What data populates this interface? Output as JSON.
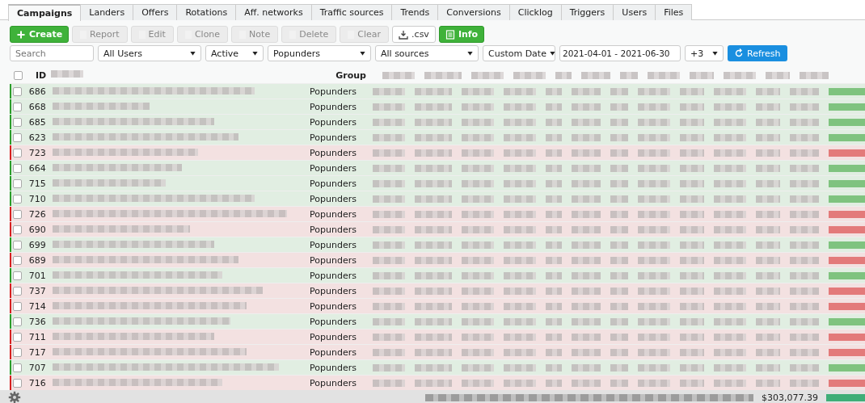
{
  "tabs": [
    {
      "label": "Campaigns",
      "selected": true
    },
    {
      "label": "Landers",
      "selected": false
    },
    {
      "label": "Offers",
      "selected": false
    },
    {
      "label": "Rotations",
      "selected": false
    },
    {
      "label": "Aff. networks",
      "selected": false
    },
    {
      "label": "Traffic sources",
      "selected": false
    },
    {
      "label": "Trends",
      "selected": false
    },
    {
      "label": "Conversions",
      "selected": false
    },
    {
      "label": "Clicklog",
      "selected": false
    },
    {
      "label": "Triggers",
      "selected": false
    },
    {
      "label": "Users",
      "selected": false
    },
    {
      "label": "Files",
      "selected": false
    }
  ],
  "toolbar": [
    {
      "label": "Create",
      "kind": "create",
      "disabled": false
    },
    {
      "label": "Report",
      "kind": "plain",
      "disabled": true
    },
    {
      "label": "Edit",
      "kind": "plain",
      "disabled": true
    },
    {
      "label": "Clone",
      "kind": "plain",
      "disabled": true
    },
    {
      "label": "Note",
      "kind": "plain",
      "disabled": true
    },
    {
      "label": "Delete",
      "kind": "plain",
      "disabled": true
    },
    {
      "label": "Clear",
      "kind": "plain",
      "disabled": true
    },
    {
      "label": ".csv",
      "kind": "download",
      "disabled": false
    },
    {
      "label": "Info",
      "kind": "info",
      "disabled": false
    }
  ],
  "filters": {
    "search": {
      "placeholder": "Search"
    },
    "user": "All Users",
    "state": "Active",
    "group": "Popunders",
    "source": "All sources",
    "period": "Custom Date",
    "dates": "2021-04-01 - 2021-06-30",
    "timezone": "+3",
    "refresh": "Refresh"
  },
  "table": {
    "columns": [
      "ID",
      "Group"
    ],
    "select_all": {
      "checked": false
    },
    "rows": [
      {
        "id": "686",
        "group": "Popunders",
        "color": "#2a9d2a",
        "checked": false
      },
      {
        "id": "668",
        "group": "Popunders",
        "color": "#2a9d2a",
        "checked": false
      },
      {
        "id": "685",
        "group": "Popunders",
        "color": "#2a9d2a",
        "checked": false
      },
      {
        "id": "623",
        "group": "Popunders",
        "color": "#2a9d2a",
        "checked": false
      },
      {
        "id": "723",
        "group": "Popunders",
        "color": "#d62020",
        "checked": false
      },
      {
        "id": "664",
        "group": "Popunders",
        "color": "#2a9d2a",
        "checked": false
      },
      {
        "id": "715",
        "group": "Popunders",
        "color": "#2a9d2a",
        "checked": false
      },
      {
        "id": "710",
        "group": "Popunders",
        "color": "#2a9d2a",
        "checked": false
      },
      {
        "id": "726",
        "group": "Popunders",
        "color": "#d62020",
        "checked": false
      },
      {
        "id": "690",
        "group": "Popunders",
        "color": "#d62020",
        "checked": false
      },
      {
        "id": "699",
        "group": "Popunders",
        "color": "#2a9d2a",
        "checked": false
      },
      {
        "id": "689",
        "group": "Popunders",
        "color": "#d62020",
        "checked": false
      },
      {
        "id": "701",
        "group": "Popunders",
        "color": "#2a9d2a",
        "checked": false
      },
      {
        "id": "737",
        "group": "Popunders",
        "color": "#d62020",
        "checked": false
      },
      {
        "id": "714",
        "group": "Popunders",
        "color": "#d62020",
        "checked": false
      },
      {
        "id": "736",
        "group": "Popunders",
        "color": "#2a9d2a",
        "checked": false
      },
      {
        "id": "711",
        "group": "Popunders",
        "color": "#d62020",
        "checked": false
      },
      {
        "id": "717",
        "group": "Popunders",
        "color": "#d62020",
        "checked": false
      },
      {
        "id": "707",
        "group": "Popunders",
        "color": "#2a9d2a",
        "checked": false
      },
      {
        "id": "716",
        "group": "Popunders",
        "color": "#d62020",
        "checked": false
      }
    ],
    "total": "$303,077.39"
  }
}
